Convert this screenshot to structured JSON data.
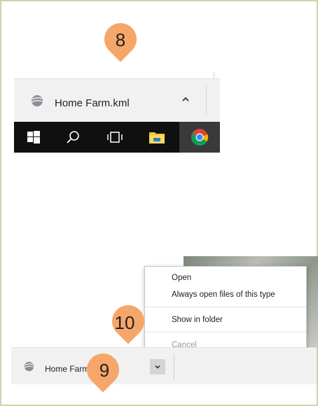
{
  "callouts": {
    "top": "8",
    "middle": "10",
    "bottom": "9"
  },
  "top_shelf": {
    "filename": "Home Farm.kml",
    "icon": "google-earth-icon",
    "chevron_icon": "chevron-up-icon"
  },
  "taskbar": {
    "items": [
      "windows-start-icon",
      "search-icon",
      "task-view-icon",
      "file-explorer-icon",
      "chrome-icon"
    ]
  },
  "context_menu": {
    "items": [
      {
        "label": "Open",
        "enabled": true
      },
      {
        "label": "Always open files of this type",
        "enabled": true
      },
      {
        "label": "Show in folder",
        "enabled": true
      },
      {
        "label": "Cancel",
        "enabled": false
      }
    ]
  },
  "bottom_shelf": {
    "filename": "Home Farm",
    "icon": "google-earth-icon",
    "dropdown_icon": "chevron-down-icon"
  },
  "colors": {
    "callout": "#f7a66a",
    "frame_border": "#cfd4a8",
    "shelf_bg": "#f1f1f1",
    "taskbar_bg": "#101010"
  }
}
